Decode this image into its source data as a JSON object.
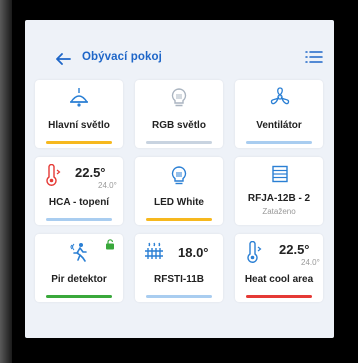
{
  "header": {
    "title": "Obývací pokoj"
  },
  "colors": {
    "accent": "#1e66c8",
    "icon": "#2a7fd4",
    "orange": "#f6b81e",
    "blue": "#a9cdf0",
    "gray": "#c8d3e0",
    "green": "#39a83b",
    "red": "#e53935"
  },
  "tiles": [
    {
      "label": "Hlavní světlo",
      "icon": "ceiling-lamp-icon",
      "status": "on"
    },
    {
      "label": "RGB světlo",
      "icon": "bulb-icon",
      "status": "off"
    },
    {
      "label": "Ventilátor",
      "icon": "fan-icon",
      "status": "off"
    },
    {
      "label": "HCA - topení",
      "icon": "thermometer-icon",
      "value": "22.5°",
      "setpoint": "24.0°"
    },
    {
      "label": "LED White",
      "icon": "bulb-icon",
      "status": "on"
    },
    {
      "label": "RFJA-12B - 2",
      "icon": "blinds-icon",
      "sublabel": "Zataženo"
    },
    {
      "label": "Pir detektor",
      "icon": "motion-icon",
      "status": "active"
    },
    {
      "label": "RFSTI-11B",
      "icon": "radiator-icon",
      "value": "18.0°"
    },
    {
      "label": "Heat cool area",
      "icon": "thermometer-icon",
      "value": "22.5°",
      "setpoint": "24.0°"
    }
  ]
}
